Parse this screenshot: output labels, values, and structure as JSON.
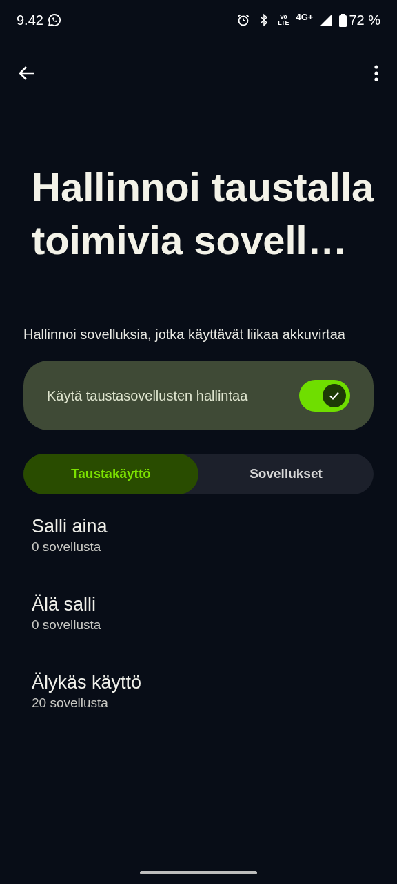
{
  "status_bar": {
    "time": "9.42",
    "network_volte": [
      "Vo",
      "LTE"
    ],
    "network": "4G+",
    "battery": "72 %"
  },
  "title": "Hallinnoi taustalla toimivia sovell…",
  "description": "Hallinnoi sovelluksia, jotka käyttävät liikaa akkuvirtaa",
  "main_switch": {
    "label": "Käytä taustasovellusten hallintaa",
    "on": true
  },
  "tabs": [
    {
      "label": "Taustakäyttö",
      "selected": true
    },
    {
      "label": "Sovellukset",
      "selected": false
    }
  ],
  "items": [
    {
      "title": "Salli aina",
      "subtitle": "0 sovellusta"
    },
    {
      "title": "Älä salli",
      "subtitle": "0 sovellusta"
    },
    {
      "title": "Älykäs käyttö",
      "subtitle": "20 sovellusta"
    }
  ]
}
